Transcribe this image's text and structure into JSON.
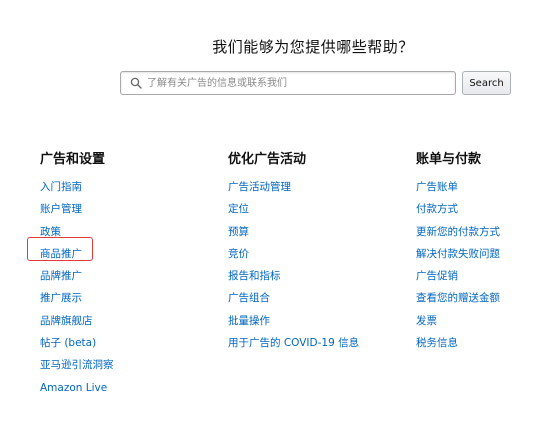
{
  "heading": "我们能够为您提供哪些帮助？",
  "search": {
    "placeholder": "了解有关广告的信息或联系我们",
    "value": "",
    "button_label": "Search"
  },
  "columns": [
    {
      "title": "广告和设置",
      "links": [
        "入门指南",
        "账户管理",
        "政策",
        "商品推广",
        "品牌推广",
        "推广展示",
        "品牌旗舰店",
        "帖子 (beta)",
        "亚马逊引流洞察",
        "Amazon Live"
      ]
    },
    {
      "title": "优化广告活动",
      "links": [
        "广告活动管理",
        "定位",
        "预算",
        "竞价",
        "报告和指标",
        "广告组合",
        "批量操作",
        "用于广告的 COVID-19 信息"
      ]
    },
    {
      "title": "账单与付款",
      "links": [
        "广告账单",
        "付款方式",
        "更新您的付款方式",
        "解决付款失败问题",
        "广告促销",
        "查看您的赠送金额",
        "发票",
        "税务信息"
      ]
    }
  ],
  "highlighted_link": "商品推广",
  "colors": {
    "link": "#0066c0",
    "highlight": "#e03a3a"
  }
}
